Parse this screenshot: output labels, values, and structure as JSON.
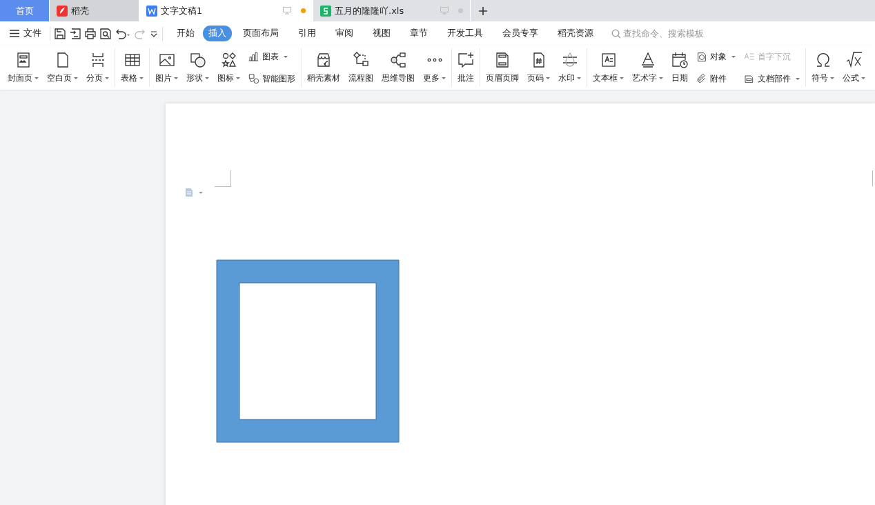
{
  "tabs": [
    {
      "kind": "home",
      "label": "首页",
      "selected": false
    },
    {
      "kind": "app",
      "label": "稻壳",
      "selected": false
    },
    {
      "kind": "doc",
      "label": "文字文稿1",
      "selected": true,
      "modified": true
    },
    {
      "kind": "sheet",
      "label": "五月的隆隆吖.xls",
      "selected": false,
      "modified": false
    }
  ],
  "menu": {
    "file_label": "文件",
    "ribbon_tabs": [
      {
        "label": "开始",
        "selected": false
      },
      {
        "label": "插入",
        "selected": true
      },
      {
        "label": "页面布局",
        "selected": false
      },
      {
        "label": "引用",
        "selected": false
      },
      {
        "label": "审阅",
        "selected": false
      },
      {
        "label": "视图",
        "selected": false
      },
      {
        "label": "章节",
        "selected": false
      },
      {
        "label": "开发工具",
        "selected": false
      },
      {
        "label": "会员专享",
        "selected": false
      },
      {
        "label": "稻壳资源",
        "selected": false
      }
    ],
    "search": {
      "placeholder": "查找命令、搜索模板"
    }
  },
  "ribbon": [
    {
      "items": [
        {
          "kind": "large",
          "label": "封面页",
          "dropdown": true
        },
        {
          "kind": "large",
          "label": "空白页",
          "dropdown": true
        },
        {
          "kind": "large",
          "label": "分页",
          "dropdown": true
        }
      ]
    },
    {
      "items": [
        {
          "kind": "large",
          "label": "表格",
          "dropdown": true
        }
      ]
    },
    {
      "items": [
        {
          "kind": "large",
          "label": "图片",
          "dropdown": true
        },
        {
          "kind": "large",
          "label": "形状",
          "dropdown": true
        },
        {
          "kind": "large",
          "label": "图标",
          "dropdown": true
        },
        {
          "kind": "stack",
          "children": [
            {
              "label": "图表",
              "dropdown": true,
              "disabled": false
            },
            {
              "label": "智能图形",
              "dropdown": false,
              "disabled": false
            }
          ]
        }
      ]
    },
    {
      "items": [
        {
          "kind": "large",
          "label": "稻壳素材",
          "dropdown": false
        },
        {
          "kind": "large",
          "label": "流程图",
          "dropdown": false
        },
        {
          "kind": "large",
          "label": "思维导图",
          "dropdown": false
        },
        {
          "kind": "large",
          "label": "更多",
          "dropdown": true
        }
      ]
    },
    {
      "items": [
        {
          "kind": "large",
          "label": "批注",
          "dropdown": false
        }
      ]
    },
    {
      "items": [
        {
          "kind": "large",
          "label": "页眉页脚",
          "dropdown": false
        },
        {
          "kind": "large",
          "label": "页码",
          "dropdown": true
        },
        {
          "kind": "large",
          "label": "水印",
          "dropdown": true
        }
      ]
    },
    {
      "items": [
        {
          "kind": "large",
          "label": "文本框",
          "dropdown": true
        },
        {
          "kind": "large",
          "label": "艺术字",
          "dropdown": true
        },
        {
          "kind": "large",
          "label": "日期",
          "dropdown": false
        },
        {
          "kind": "stack",
          "children": [
            {
              "label": "对象",
              "dropdown": true,
              "disabled": false
            },
            {
              "label": "附件",
              "dropdown": false,
              "disabled": false
            }
          ]
        },
        {
          "kind": "stack",
          "children": [
            {
              "label": "首字下沉",
              "dropdown": false,
              "disabled": true
            },
            {
              "label": "文档部件",
              "dropdown": true,
              "disabled": false
            }
          ]
        }
      ]
    },
    {
      "items": [
        {
          "kind": "large",
          "label": "符号",
          "dropdown": true
        },
        {
          "kind": "large",
          "label": "公式",
          "dropdown": true
        }
      ]
    }
  ],
  "document": {
    "shape": {
      "kind": "frame"
    }
  }
}
